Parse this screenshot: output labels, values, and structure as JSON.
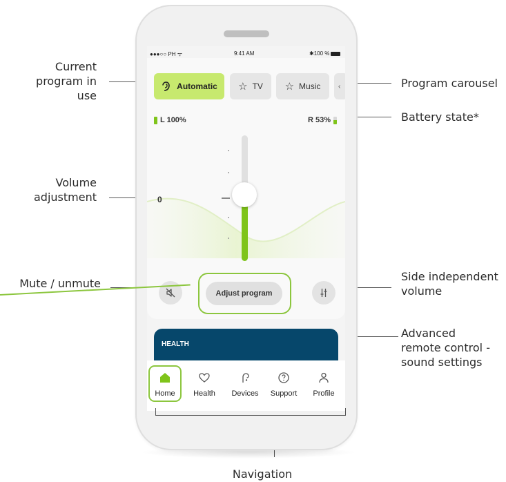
{
  "callouts": {
    "current_program": "Current\nprogram in use",
    "program_carousel": "Program carousel",
    "battery_state": "Battery state*",
    "volume_adjustment": "Volume\nadjustment",
    "mute_unmute": "Mute / unmute",
    "side_independent": "Side independent\nvolume",
    "advanced_remote": "Advanced\nremote control -\nsound settings",
    "navigation": "Navigation"
  },
  "status_bar": {
    "carrier": "●●●○○ PH ᯤ",
    "time": "9:41 AM",
    "battery": "✱100 %"
  },
  "programs": [
    {
      "label": "Automatic",
      "icon": "ear-icon",
      "active": true
    },
    {
      "label": "TV",
      "icon": "star-icon",
      "active": false
    },
    {
      "label": "Music",
      "icon": "star-icon",
      "active": false
    }
  ],
  "battery_levels": {
    "left": "L 100%",
    "right": "R 53%",
    "left_fraction": 1.0,
    "right_fraction": 0.53
  },
  "volume": {
    "value": "0",
    "level_fraction": 0.5
  },
  "buttons": {
    "adjust_program": "Adjust program"
  },
  "health_card": {
    "title": "HEALTH"
  },
  "nav": [
    {
      "label": "Home",
      "icon": "home-icon",
      "active": true
    },
    {
      "label": "Health",
      "icon": "heart-icon",
      "active": false
    },
    {
      "label": "Devices",
      "icon": "hearing-aid-icon",
      "active": false
    },
    {
      "label": "Support",
      "icon": "help-icon",
      "active": false
    },
    {
      "label": "Profile",
      "icon": "person-icon",
      "active": false
    }
  ],
  "colors": {
    "accent_green": "#c7e96e",
    "highlight_green": "#8cc63e",
    "slider_green": "#7fc41a",
    "health_blue": "#06476b"
  }
}
